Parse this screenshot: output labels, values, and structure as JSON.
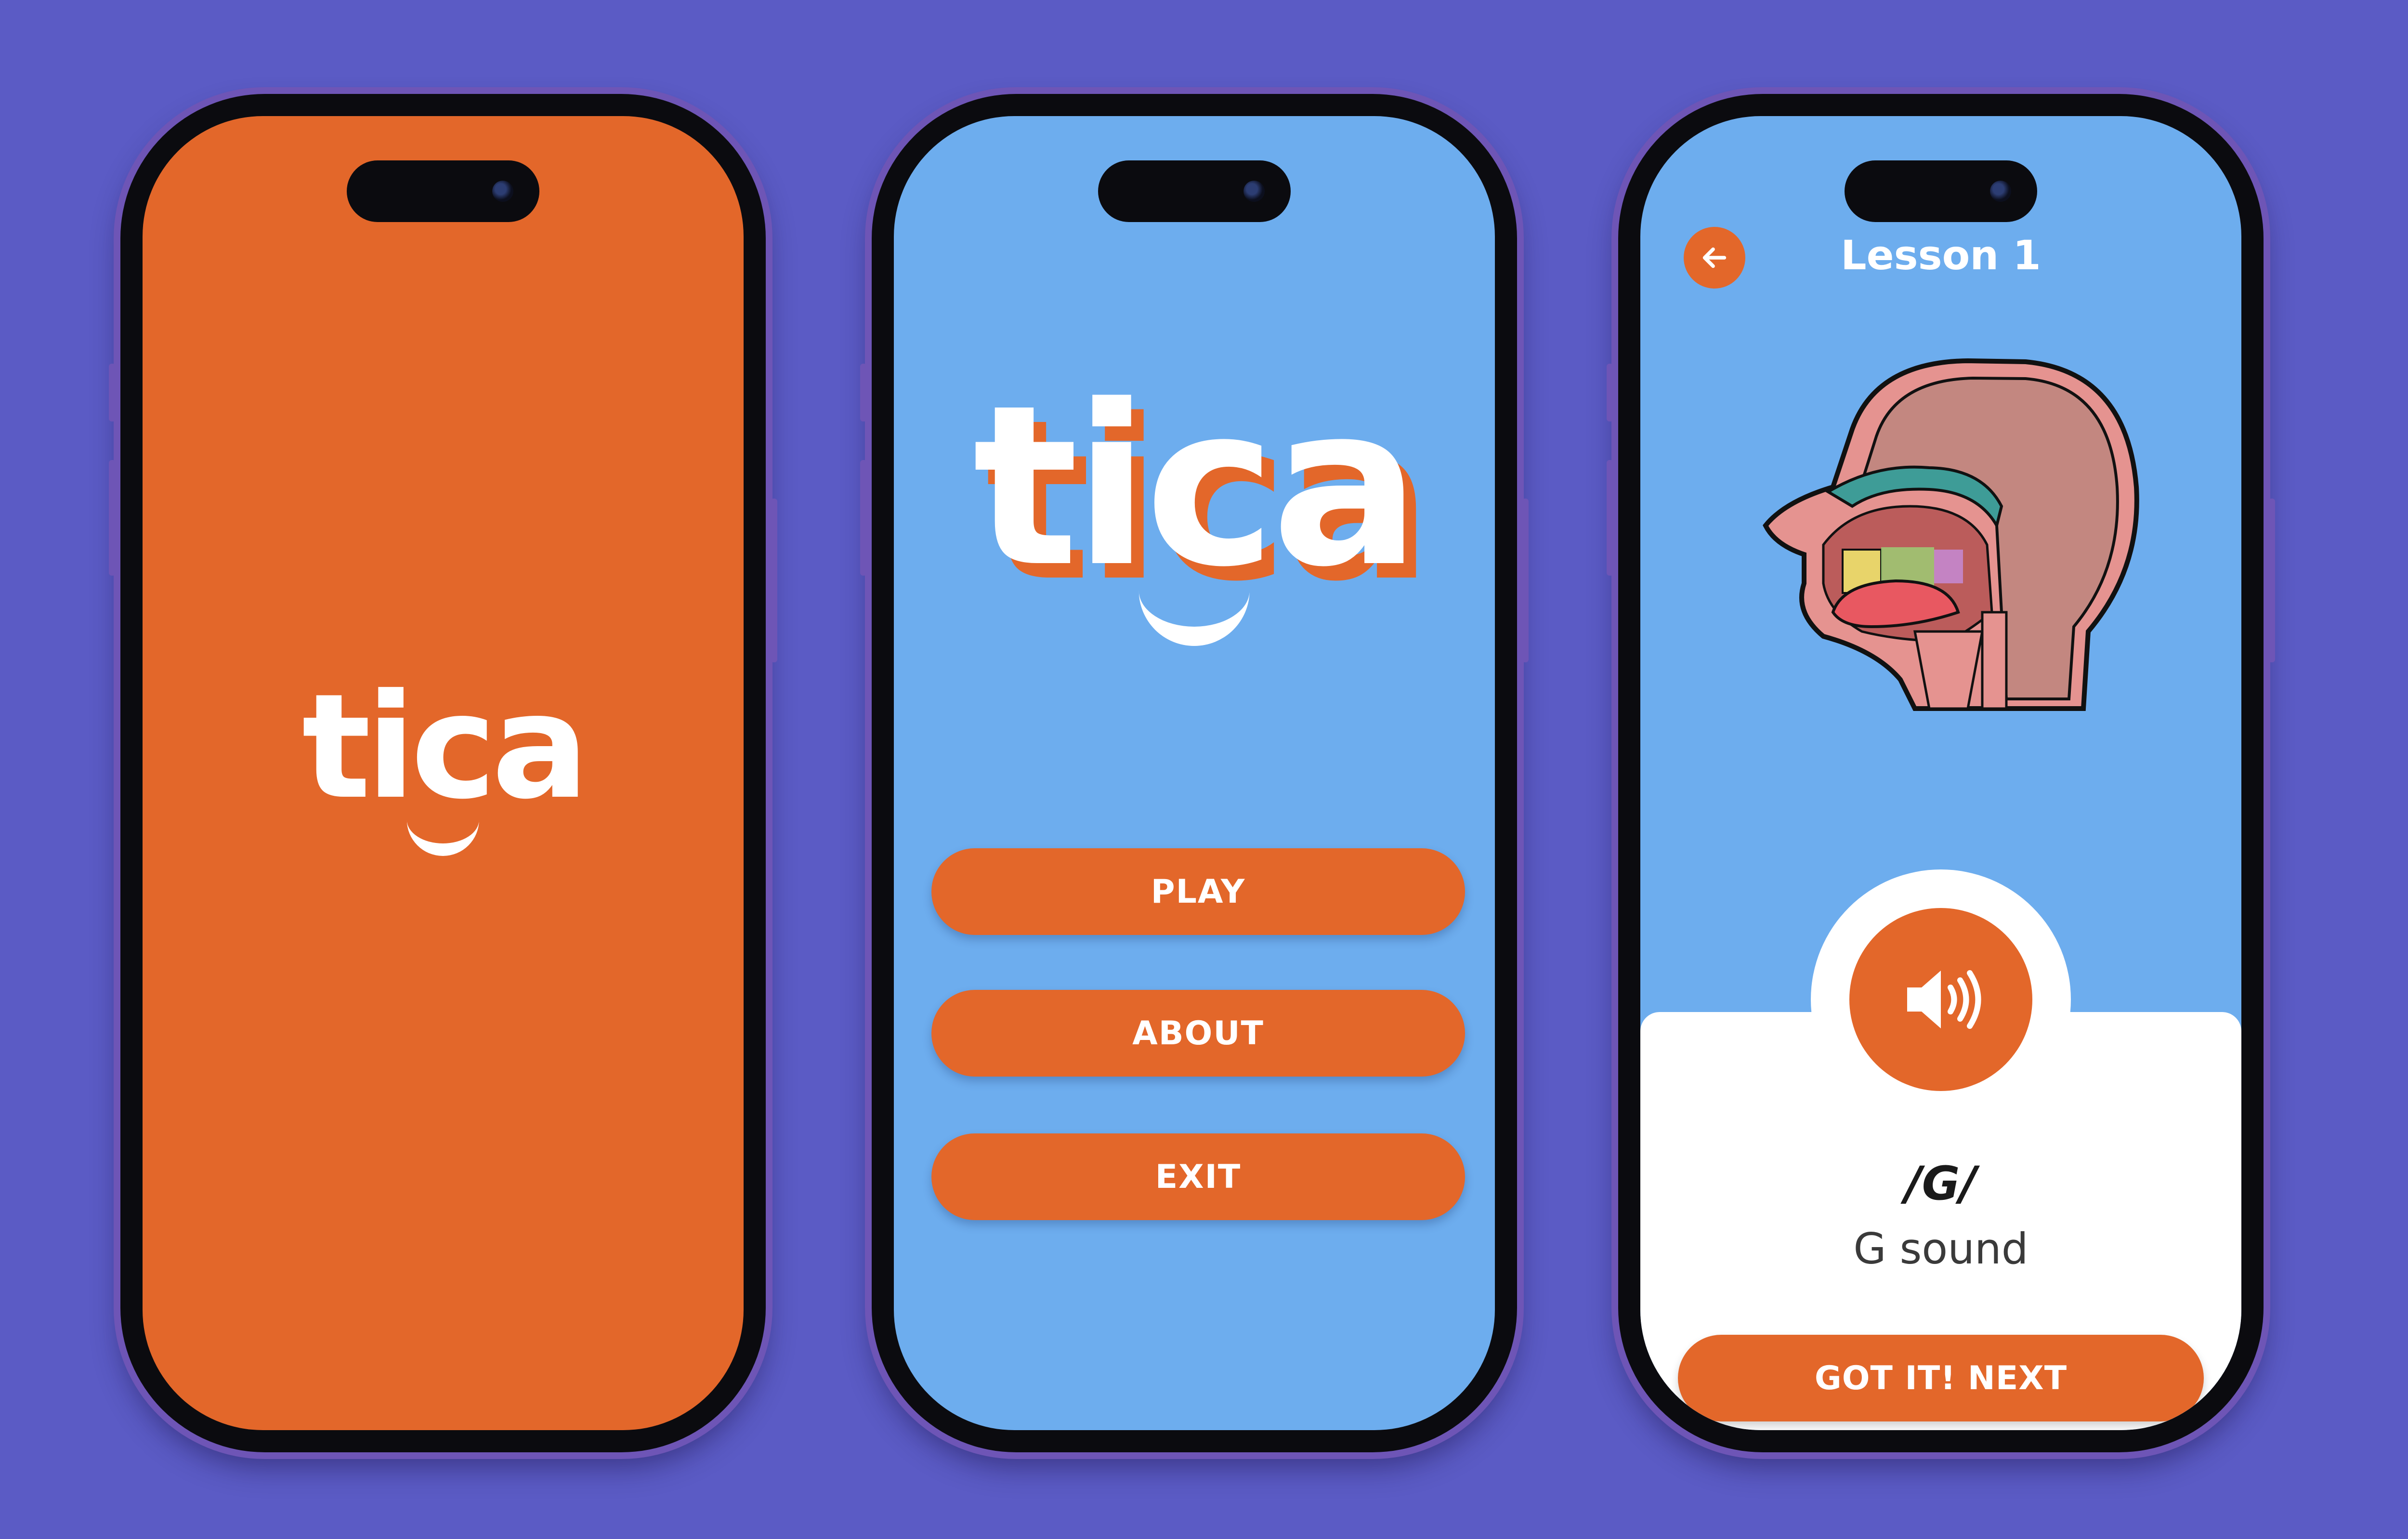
{
  "colors": {
    "background": "#5B5BC5",
    "orange": "#E3672A",
    "blue": "#6DADEE",
    "white": "#FFFFFF"
  },
  "splash": {
    "logo_text": "tica"
  },
  "menu": {
    "logo_text": "tica",
    "buttons": [
      {
        "label": "PLAY"
      },
      {
        "label": "ABOUT"
      },
      {
        "label": "EXIT"
      }
    ]
  },
  "lesson": {
    "title": "Lesson 1",
    "diagram_icon": "head-cross-section-illustration",
    "audio_icon": "speaker-icon",
    "back_icon": "arrow-left-icon",
    "phoneme": "/G/",
    "sound_label": "G sound",
    "next_label": "GOT IT! NEXT"
  }
}
